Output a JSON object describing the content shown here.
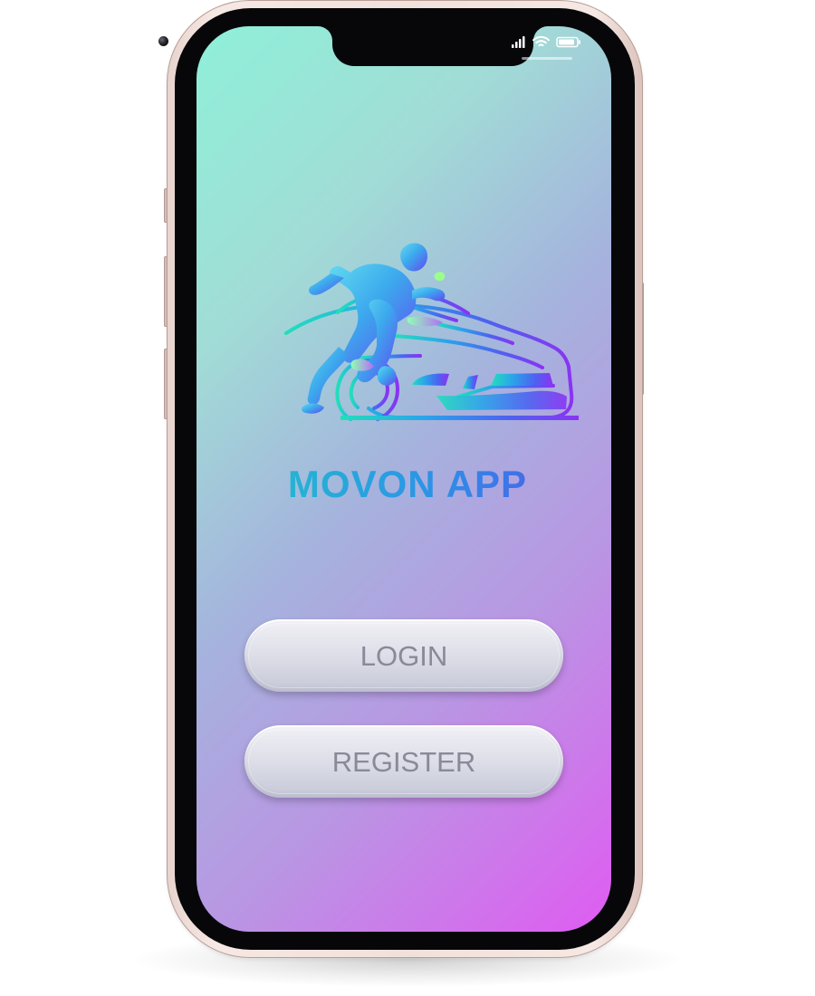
{
  "app": {
    "title": "MOVON APP"
  },
  "auth": {
    "login_label": "LOGIN",
    "register_label": "REGISTER"
  },
  "status_bar": {
    "signal_icon": "signal-bars-icon",
    "wifi_icon": "wifi-icon",
    "battery_icon": "battery-icon"
  },
  "logo": {
    "icon": "runner-car-logo"
  },
  "colors": {
    "screen_gradient_start": "#8ff0d8",
    "screen_gradient_end": "#df5cf1",
    "title_gradient_start": "#18dcb6",
    "title_gradient_end": "#7a2ff2",
    "button_text": "#8a8998"
  }
}
